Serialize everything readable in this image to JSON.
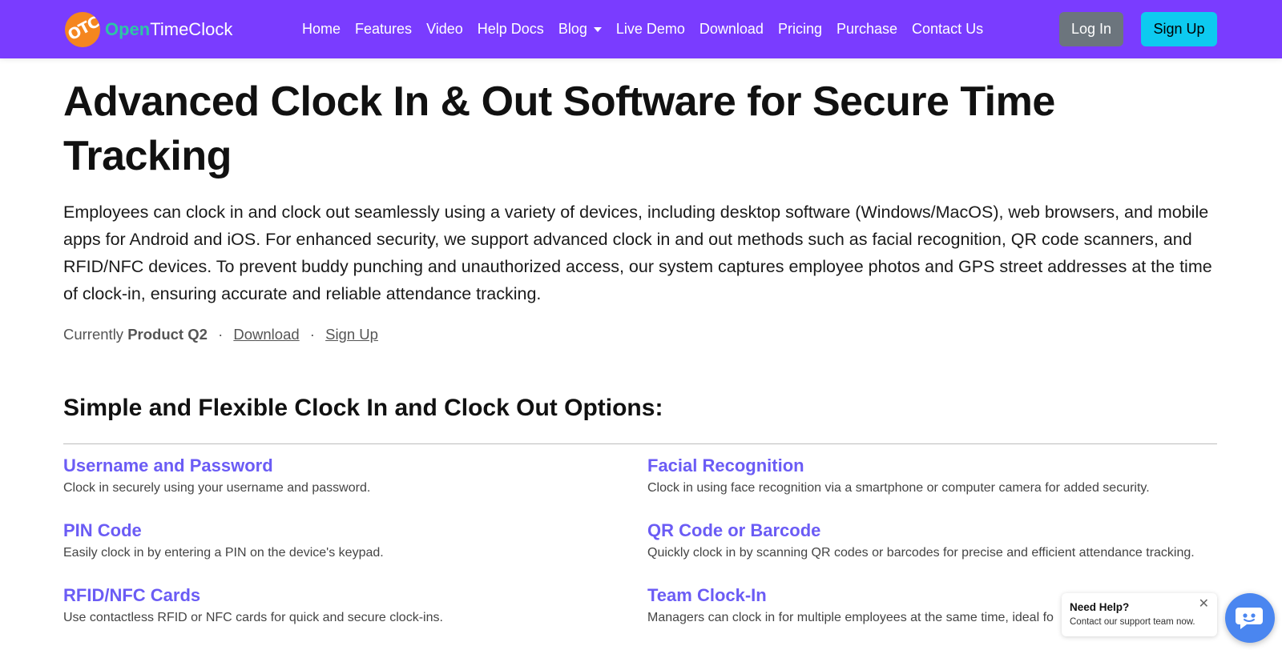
{
  "brand": {
    "logo_text": "OTC",
    "name_open": "Open",
    "name_rest": "TimeClock"
  },
  "nav": {
    "items": [
      {
        "label": "Home"
      },
      {
        "label": "Features"
      },
      {
        "label": "Video"
      },
      {
        "label": "Help Docs"
      },
      {
        "label": "Blog",
        "dropdown": true
      },
      {
        "label": "Live Demo"
      },
      {
        "label": "Download"
      },
      {
        "label": "Pricing"
      },
      {
        "label": "Purchase"
      },
      {
        "label": "Contact Us"
      }
    ],
    "login_label": "Log In",
    "signup_label": "Sign Up"
  },
  "hero": {
    "title": "Advanced Clock In & Out Software for Secure Time Tracking",
    "description": "Employees can clock in and clock out seamlessly using a variety of devices, including desktop software (Windows/MacOS), web browsers, and mobile apps for Android and iOS. For enhanced security, we support advanced clock in and out methods such as facial recognition, QR code scanners, and RFID/NFC devices. To prevent buddy punching and unauthorized access, our system captures employee photos and GPS street addresses at the time of clock-in, ensuring accurate and reliable attendance tracking.",
    "meta_prefix": "Currently",
    "meta_product": "Product Q2",
    "separator": "·",
    "download_link": "Download",
    "signup_link": "Sign Up"
  },
  "options_section": {
    "title": "Simple and Flexible Clock In and Clock Out Options:",
    "items": [
      {
        "title": "Username and Password",
        "desc": "Clock in securely using your username and password."
      },
      {
        "title": "Facial Recognition",
        "desc": "Clock in using face recognition via a smartphone or computer camera for added security."
      },
      {
        "title": "PIN Code",
        "desc": "Easily clock in by entering a PIN on the device's keypad."
      },
      {
        "title": "QR Code or Barcode",
        "desc": "Quickly clock in by scanning QR codes or barcodes for precise and efficient attendance tracking."
      },
      {
        "title": "RFID/NFC Cards",
        "desc": "Use contactless RFID or NFC cards for quick and secure clock-ins."
      },
      {
        "title": "Team Clock-In",
        "desc": "Managers can clock in for multiple employees at the same time, ideal fo"
      }
    ]
  },
  "help_widget": {
    "title": "Need Help?",
    "subtitle": "Contact our support team now.",
    "close_glyph": "✕",
    "icon": "chat-bot-icon"
  },
  "colors": {
    "navbar": "#7a3cff",
    "accent_link": "#6b5cf5",
    "login_button": "#6c757d",
    "signup_button": "#0dcaf0",
    "logo": "#f5861f",
    "brand_open": "#2ec4a6"
  }
}
